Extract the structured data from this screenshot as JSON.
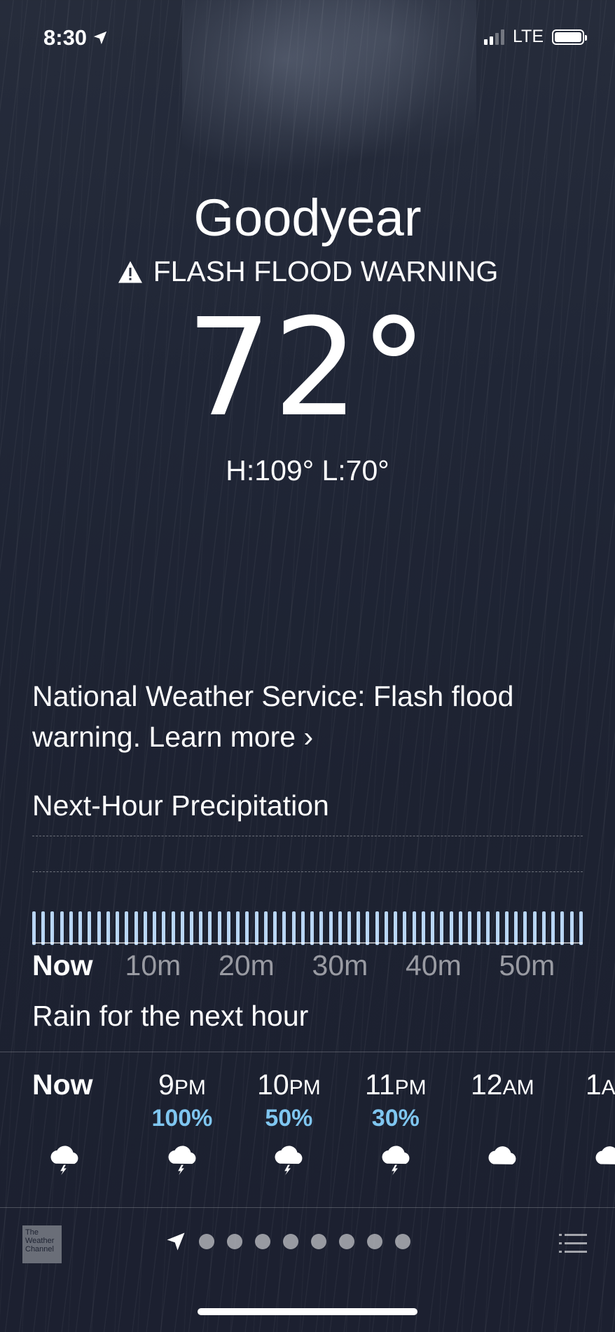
{
  "status": {
    "time": "8:30",
    "network": "LTE"
  },
  "location": {
    "city": "Goodyear",
    "alert": "FLASH FLOOD WARNING",
    "temperature": "72°",
    "high_low": "H:109°  L:70°"
  },
  "nws_notice": {
    "text": "National Weather Service: Flash flood warning.",
    "link": "Learn more"
  },
  "precipitation": {
    "title": "Next-Hour Precipitation",
    "labels": [
      "Now",
      "10m",
      "20m",
      "30m",
      "40m",
      "50m"
    ],
    "summary": "Rain for the next hour",
    "intensity_fraction": 1.0
  },
  "hourly": [
    {
      "time": "Now",
      "suffix": "",
      "chance": "",
      "icon": "thunderstorm-icon"
    },
    {
      "time": "9",
      "suffix": "PM",
      "chance": "100%",
      "icon": "thunderstorm-icon"
    },
    {
      "time": "10",
      "suffix": "PM",
      "chance": "50%",
      "icon": "thunderstorm-icon"
    },
    {
      "time": "11",
      "suffix": "PM",
      "chance": "30%",
      "icon": "thunderstorm-icon"
    },
    {
      "time": "12",
      "suffix": "AM",
      "chance": "",
      "icon": "cloud-icon"
    },
    {
      "time": "1",
      "suffix": "AM",
      "chance": "",
      "icon": "cloud-icon"
    }
  ],
  "footer": {
    "provider": "The Weather Channel",
    "page_dots": 8
  },
  "colors": {
    "precip_bar": "#b9d6f5",
    "chance_text": "#7fc6f0"
  }
}
